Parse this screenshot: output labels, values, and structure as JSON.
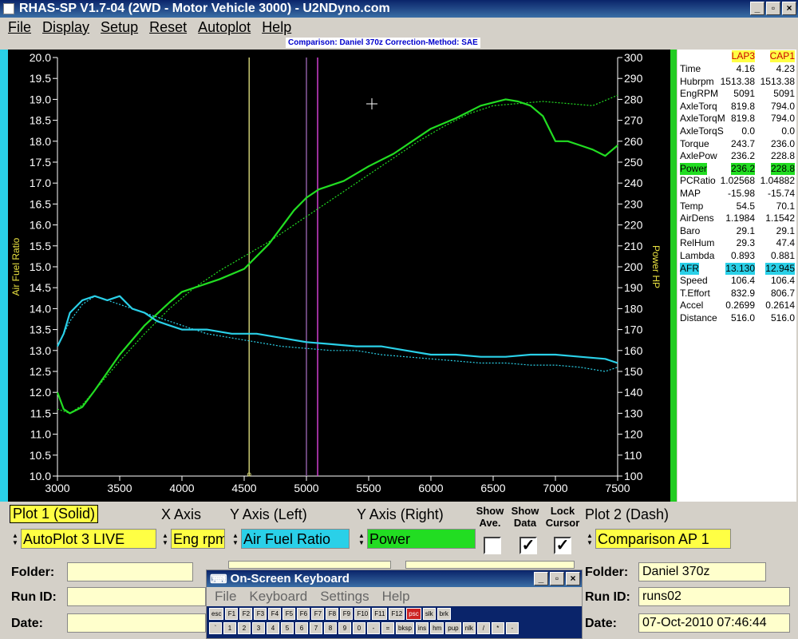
{
  "window": {
    "title": "RHAS-SP V1.7-04   (2WD - Motor Vehicle 3000) - U2NDyno.com",
    "minimize": "_",
    "restore": "▫",
    "close": "×"
  },
  "menu": [
    "File",
    "Display",
    "Setup",
    "Reset",
    "Autoplot",
    "Help"
  ],
  "subtitle": "Comparison: Daniel 370z    Correction-Method: SAE",
  "chart_data": {
    "type": "line",
    "xlabel": "",
    "ylabel": "Air Fuel Ratio",
    "y2label": "Power HP",
    "xlim": [
      3000,
      7500
    ],
    "ylim": [
      10.0,
      20.0
    ],
    "y2lim": [
      100,
      300
    ],
    "xticks": [
      3000,
      3500,
      4000,
      4500,
      5000,
      5500,
      6000,
      6500,
      7000,
      7500
    ],
    "yticks": [
      "10.0",
      "10.5",
      "11.0",
      "11.5",
      "12.0",
      "12.5",
      "13.0",
      "13.5",
      "14.0",
      "14.5",
      "15.0",
      "15.5",
      "16.0",
      "16.5",
      "17.0",
      "17.5",
      "18.0",
      "18.5",
      "19.0",
      "19.5",
      "20.0"
    ],
    "y2ticks": [
      100,
      110,
      120,
      130,
      140,
      150,
      160,
      170,
      180,
      190,
      200,
      210,
      220,
      230,
      240,
      250,
      260,
      270,
      280,
      290,
      300
    ],
    "cursors": [
      {
        "x": 4540,
        "color": "#c8c870"
      },
      {
        "x": 5000,
        "color": "#8a5aa0"
      },
      {
        "x": 5090,
        "color": "#d040d0"
      }
    ],
    "series": [
      {
        "color": "#22dd22",
        "dash": false,
        "axis": "right",
        "x": [
          3000,
          3050,
          3100,
          3200,
          3300,
          3500,
          3700,
          3900,
          4000,
          4100,
          4300,
          4500,
          4700,
          4900,
          5000,
          5100,
          5300,
          5500,
          5700,
          5900,
          6000,
          6200,
          6400,
          6600,
          6700,
          6800,
          6900,
          7000,
          7100,
          7200,
          7300,
          7400,
          7500
        ],
        "y": [
          140,
          132,
          130,
          133,
          141,
          158,
          172,
          183,
          188,
          190,
          194,
          199,
          211,
          227,
          233,
          237,
          241,
          248,
          254,
          262,
          266,
          271,
          277,
          280,
          279,
          277,
          272,
          260,
          260,
          258,
          256,
          253,
          258
        ]
      },
      {
        "color": "#22dd22",
        "dash": true,
        "axis": "right",
        "x": [
          3000,
          3100,
          3200,
          3300,
          3500,
          3700,
          3900,
          4100,
          4300,
          4500,
          4700,
          4900,
          5100,
          5300,
          5500,
          5700,
          5900,
          6100,
          6300,
          6500,
          6700,
          6900,
          7100,
          7300,
          7500
        ],
        "y": [
          132,
          130,
          134,
          141,
          155,
          168,
          180,
          190,
          198,
          205,
          212,
          220,
          228,
          236,
          244,
          252,
          260,
          267,
          273,
          277,
          278,
          279,
          278,
          277,
          282
        ]
      },
      {
        "color": "#2ad0e8",
        "dash": false,
        "axis": "left",
        "x": [
          3000,
          3050,
          3100,
          3200,
          3300,
          3400,
          3500,
          3600,
          3700,
          3800,
          3900,
          4000,
          4200,
          4400,
          4600,
          4800,
          5000,
          5200,
          5400,
          5600,
          5800,
          6000,
          6200,
          6400,
          6600,
          6800,
          7000,
          7200,
          7400,
          7500
        ],
        "y": [
          13.1,
          13.4,
          13.9,
          14.2,
          14.3,
          14.2,
          14.3,
          14.0,
          13.9,
          13.7,
          13.6,
          13.5,
          13.5,
          13.4,
          13.4,
          13.3,
          13.2,
          13.15,
          13.1,
          13.1,
          13.0,
          12.9,
          12.9,
          12.85,
          12.85,
          12.9,
          12.9,
          12.85,
          12.8,
          12.7
        ]
      },
      {
        "color": "#2ad0e8",
        "dash": true,
        "axis": "left",
        "x": [
          3000,
          3100,
          3200,
          3300,
          3400,
          3600,
          3800,
          4000,
          4200,
          4400,
          4600,
          4800,
          5000,
          5200,
          5400,
          5600,
          5800,
          6000,
          6200,
          6400,
          6600,
          6800,
          7000,
          7200,
          7400,
          7500
        ],
        "y": [
          13.1,
          13.7,
          14.1,
          14.3,
          14.2,
          14.0,
          13.8,
          13.6,
          13.4,
          13.3,
          13.2,
          13.1,
          13.05,
          13.0,
          13.0,
          12.9,
          12.85,
          12.8,
          12.75,
          12.7,
          12.7,
          12.65,
          12.65,
          12.6,
          12.5,
          12.6
        ]
      }
    ]
  },
  "datapanel": {
    "header": {
      "c1": "LAP3",
      "c2": "CAP1"
    },
    "rows": [
      {
        "label": "Time",
        "v1": "4.16",
        "v2": "4.23",
        "hl": ""
      },
      {
        "label": "Hubrpm",
        "v1": "1513.38",
        "v2": "1513.38",
        "hl": ""
      },
      {
        "label": "EngRPM",
        "v1": "5091",
        "v2": "5091",
        "hl": ""
      },
      {
        "label": "AxleTorq",
        "v1": "819.8",
        "v2": "794.0",
        "hl": ""
      },
      {
        "label": "AxleTorqM",
        "v1": "819.8",
        "v2": "794.0",
        "hl": ""
      },
      {
        "label": "AxleTorqS",
        "v1": "0.0",
        "v2": "0.0",
        "hl": ""
      },
      {
        "label": "Torque",
        "v1": "243.7",
        "v2": "236.0",
        "hl": ""
      },
      {
        "label": "AxlePow",
        "v1": "236.2",
        "v2": "228.8",
        "hl": ""
      },
      {
        "label": "Power",
        "v1": "236.2",
        "v2": "228.8",
        "hl": "green"
      },
      {
        "label": "PCRatio",
        "v1": "1.02568",
        "v2": "1.04882",
        "hl": ""
      },
      {
        "label": "MAP",
        "v1": "-15.98",
        "v2": "-15.74",
        "hl": ""
      },
      {
        "label": "Temp",
        "v1": "54.5",
        "v2": "70.1",
        "hl": ""
      },
      {
        "label": "AirDens",
        "v1": "1.1984",
        "v2": "1.1542",
        "hl": ""
      },
      {
        "label": "Baro",
        "v1": "29.1",
        "v2": "29.1",
        "hl": ""
      },
      {
        "label": "RelHum",
        "v1": "29.3",
        "v2": "47.4",
        "hl": ""
      },
      {
        "label": "Lambda",
        "v1": "0.893",
        "v2": "0.881",
        "hl": ""
      },
      {
        "label": "AFR",
        "v1": "13.130",
        "v2": "12.945",
        "hl": "cyan"
      },
      {
        "label": "Speed",
        "v1": "106.4",
        "v2": "106.4",
        "hl": ""
      },
      {
        "label": "T.Effort",
        "v1": "832.9",
        "v2": "806.7",
        "hl": ""
      },
      {
        "label": "Accel",
        "v1": "0.2699",
        "v2": "0.2614",
        "hl": ""
      },
      {
        "label": "Distance",
        "v1": "516.0",
        "v2": "516.0",
        "hl": ""
      }
    ]
  },
  "controls": {
    "plot1_label": "Plot 1 (Solid)",
    "xaxis_label": "X Axis",
    "yleft_label": "Y Axis (Left)",
    "yright_label": "Y Axis (Right)",
    "show_ave_label": "Show Ave.",
    "show_data_label": "Show Data",
    "lock_cursor_label": "Lock Cursor",
    "plot2_label": "Plot 2 (Dash)",
    "plot1_value": "AutoPlot 3 LIVE",
    "xaxis_value": "Eng rpm",
    "yleft_value": "Air Fuel Ratio",
    "yright_value": "Power",
    "plot2_value": "Comparison AP 1",
    "show_ave_checked": "",
    "show_data_checked": "✓",
    "lock_cursor_checked": "✓"
  },
  "fields": {
    "folder_label": "Folder:",
    "runid_label": "Run ID:",
    "date_label": "Date:",
    "left_folder": "",
    "left_runid": "",
    "left_date": "",
    "right_folder": "Daniel 370z",
    "right_runid": "runs02",
    "right_date": "07-Oct-2010  07:46:44"
  },
  "osk": {
    "title": "On-Screen Keyboard",
    "menu": [
      "File",
      "Keyboard",
      "Settings",
      "Help"
    ],
    "row1": [
      "esc",
      "F1",
      "F2",
      "F3",
      "F4",
      "F5",
      "F6",
      "F7",
      "F8",
      "F9",
      "F10",
      "F11",
      "F12",
      "psc",
      "slk",
      "brk"
    ],
    "row2": [
      "`",
      "1",
      "2",
      "3",
      "4",
      "5",
      "6",
      "7",
      "8",
      "9",
      "0",
      "-",
      "=",
      "bksp",
      "ins",
      "hm",
      "pup",
      "nlk",
      "/",
      "*",
      "-"
    ]
  }
}
